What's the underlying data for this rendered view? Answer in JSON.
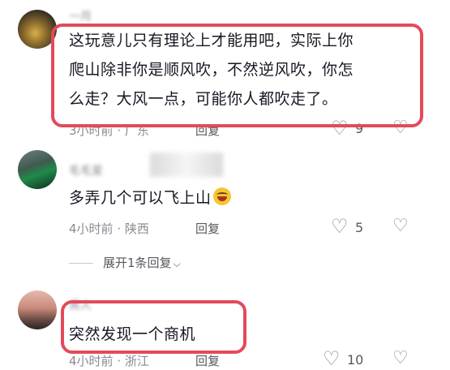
{
  "comments": [
    {
      "username": "一月",
      "text_lines": [
        "这玩意儿只有理论上才能用吧，实际上你",
        "爬山除非你是顺风吹，不然逆风吹，你怎",
        "么走？大风一点，可能你人都吹走了。"
      ],
      "time": "3小时前",
      "location": "广东",
      "reply_label": "回复",
      "like_count": "9"
    },
    {
      "username": "毛毛爱",
      "text": "多弄几个可以飞上山",
      "emoji": "rolling-on-floor-laughing",
      "time": "4小时前",
      "location": "陕西",
      "reply_label": "回复",
      "like_count": "5",
      "expand_label": "展开1条回复"
    },
    {
      "username": "男人",
      "text": "突然发现一个商机",
      "time": "4小时前",
      "location": "浙江",
      "reply_label": "回复",
      "like_count": "10"
    }
  ],
  "colors": {
    "highlight": "#e34a5b",
    "meta": "#8a8b91",
    "text": "#161823"
  },
  "icons": {
    "like": "heart-outline-icon",
    "dislike": "broken-heart-outline-icon",
    "expand": "chevron-down-icon"
  }
}
